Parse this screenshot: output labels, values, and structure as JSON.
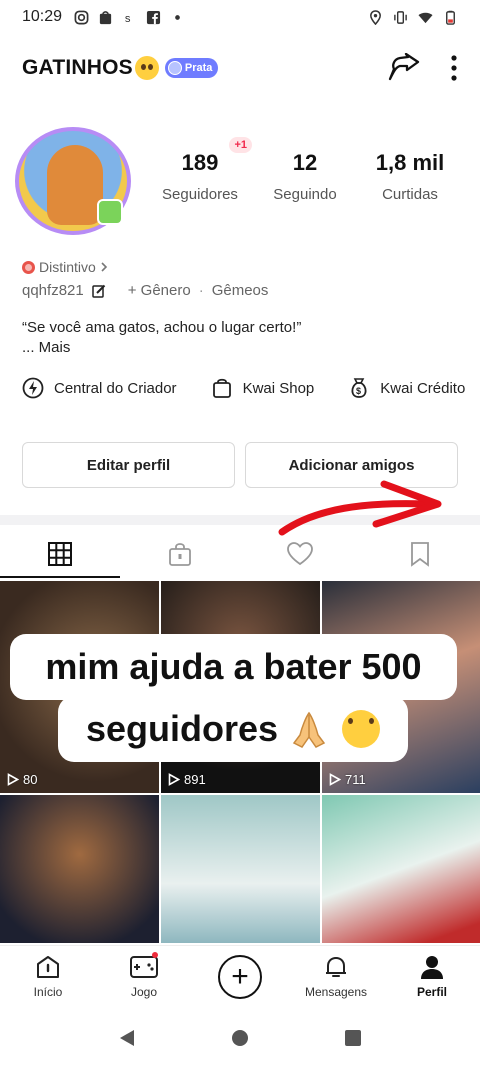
{
  "status_bar": {
    "time": "10:29"
  },
  "header": {
    "username": "GATINHOS",
    "badge_label": "Prata"
  },
  "profile": {
    "stats": [
      {
        "value": "189",
        "label": "Seguidores",
        "notice": "+1"
      },
      {
        "value": "12",
        "label": "Seguindo"
      },
      {
        "value": "1,8 mil",
        "label": "Curtidas"
      }
    ],
    "distintivo": "Distintivo",
    "user_id": "qqhfz821",
    "gender_label": "+ Gênero",
    "sign": "Gêmeos",
    "bio": "“Se você ama gatos, achou o lugar certo!”",
    "bio_more": "...  Mais"
  },
  "creator_links": [
    {
      "label": "Central do Criador",
      "icon": "lightning-icon"
    },
    {
      "label": "Kwai Shop",
      "icon": "shopping-bag-icon"
    },
    {
      "label": "Kwai Crédito",
      "icon": "money-bag-icon"
    }
  ],
  "buttons": {
    "edit_profile": "Editar perfil",
    "add_friends": "Adicionar amigos"
  },
  "tabs": [
    {
      "name": "grid-icon",
      "active": true
    },
    {
      "name": "locked-bag-icon",
      "active": false
    },
    {
      "name": "heart-icon",
      "active": false
    },
    {
      "name": "bookmark-icon",
      "active": false
    }
  ],
  "videos": [
    {
      "views": "80"
    },
    {
      "views": "891"
    },
    {
      "views": "711"
    },
    {
      "views": ""
    },
    {
      "views": ""
    },
    {
      "views": ""
    }
  ],
  "overlay_caption": {
    "line1": "mim ajuda a bater 500",
    "line2": "seguidores"
  },
  "bottom_nav": [
    {
      "label": "Início",
      "icon": "home-icon"
    },
    {
      "label": "Jogo",
      "icon": "gamepad-icon"
    },
    {
      "label": "",
      "icon": "plus-icon"
    },
    {
      "label": "Mensagens",
      "icon": "bell-icon"
    },
    {
      "label": "Perfil",
      "icon": "person-icon"
    }
  ],
  "colors": {
    "accent_red": "#ee2b3b",
    "badge_blue": "#6f7cff"
  }
}
